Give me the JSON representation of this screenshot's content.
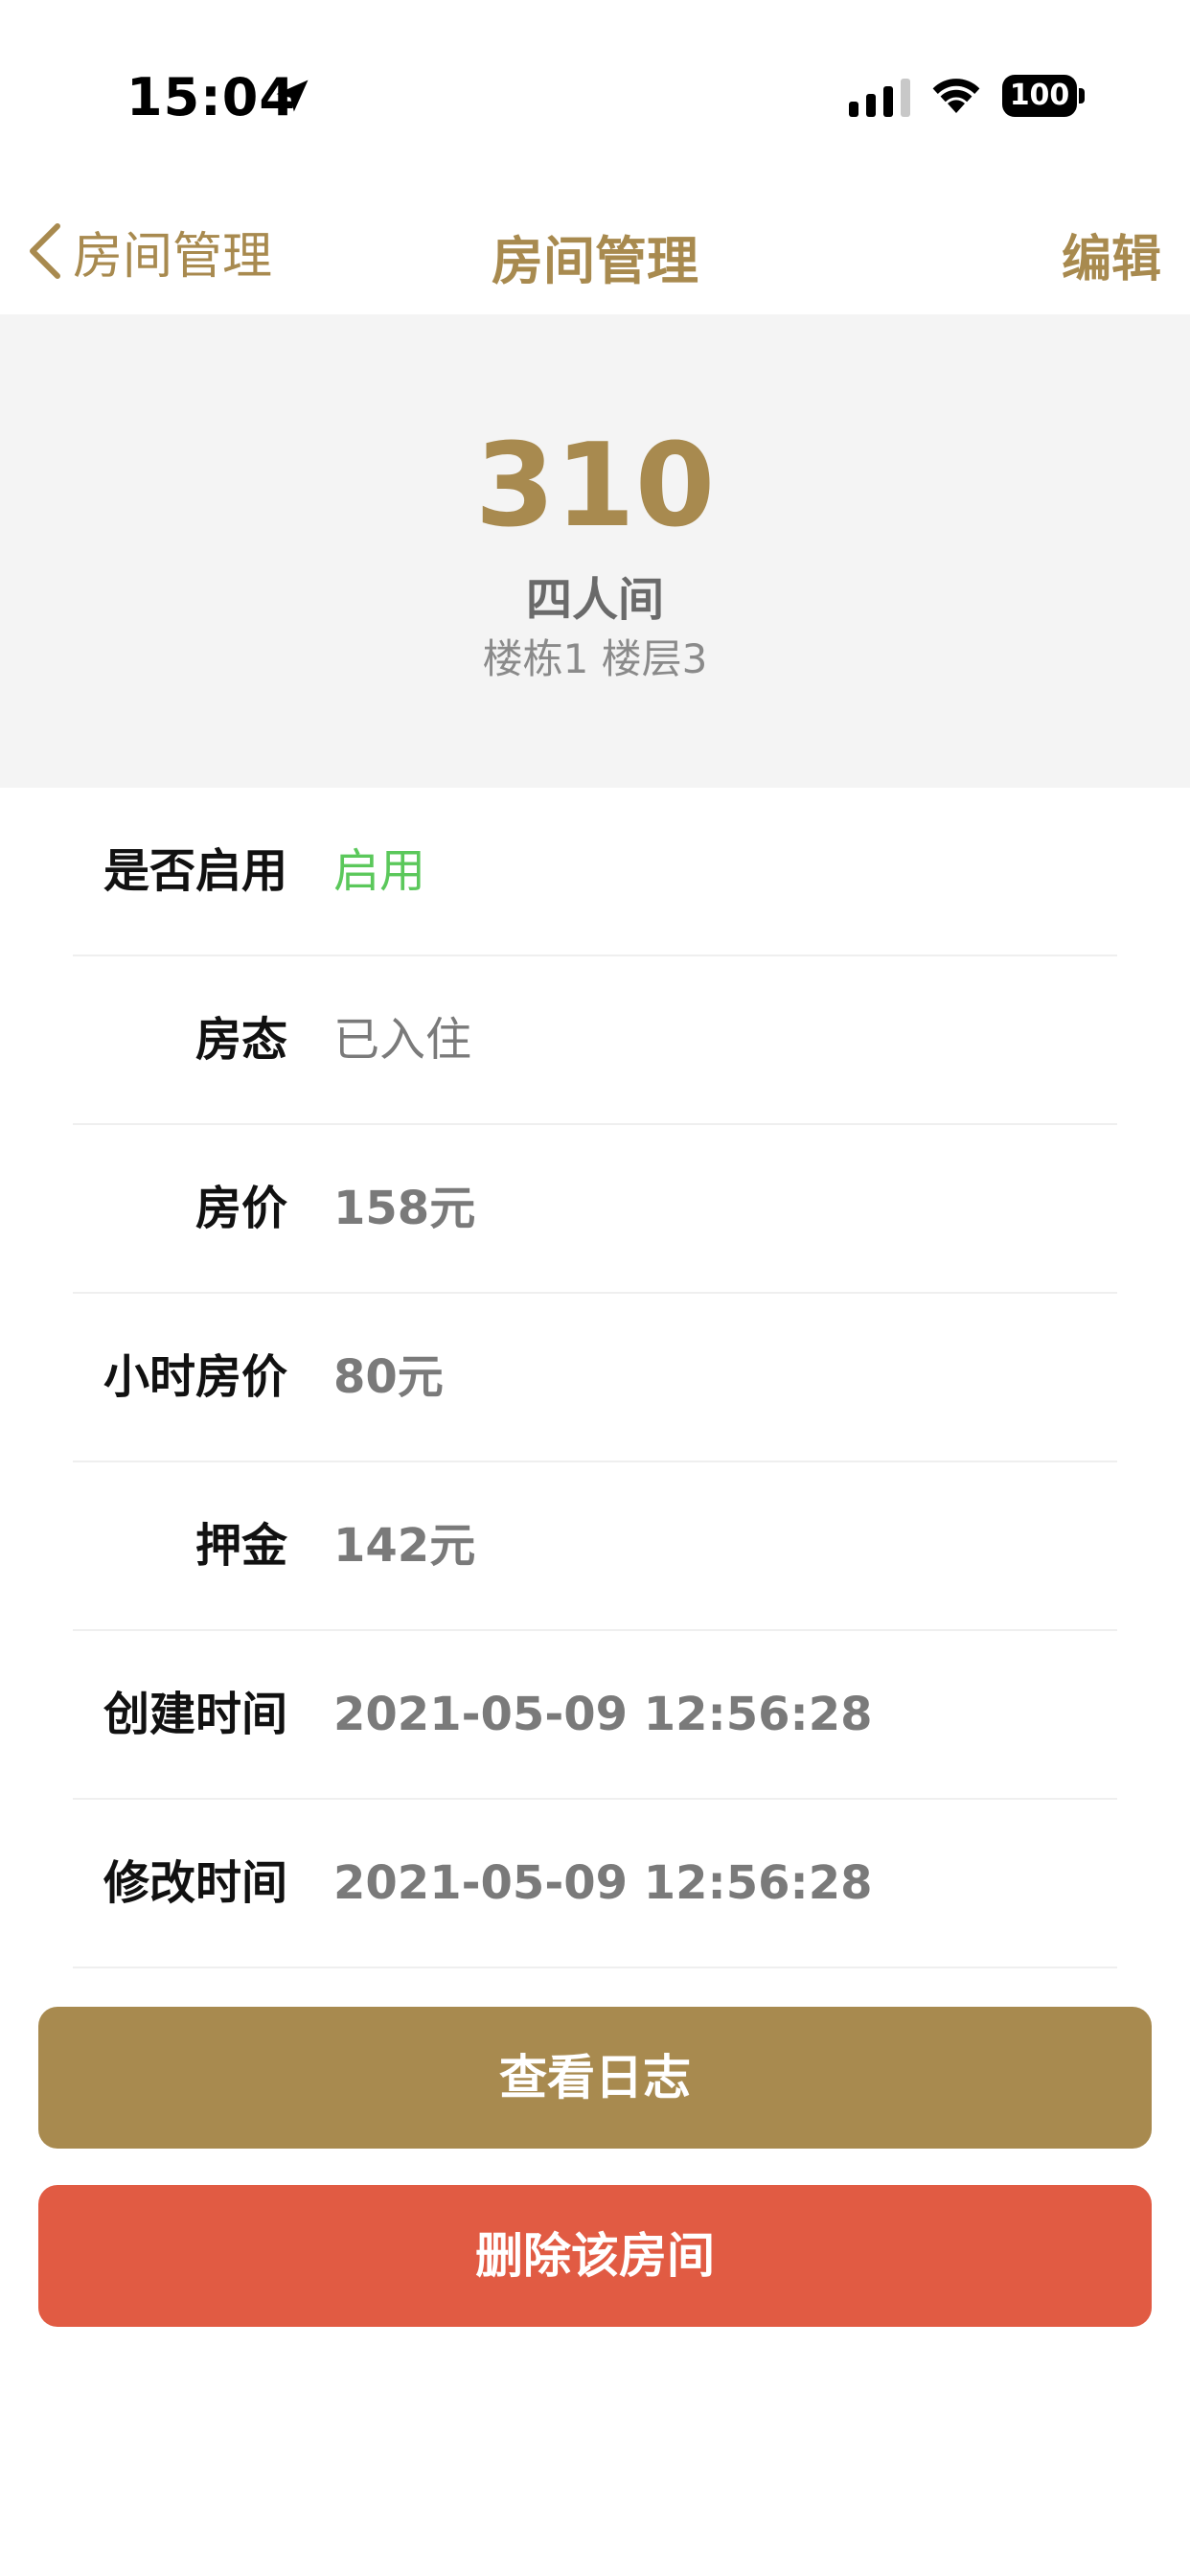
{
  "status_bar": {
    "time": "15:04",
    "battery": "100",
    "icons": [
      "location-arrow-icon",
      "cellular-signal-icon",
      "wifi-icon",
      "battery-icon"
    ]
  },
  "nav": {
    "back_label": "房间管理",
    "title": "房间管理",
    "edit_label": "编辑",
    "accent_color": "#A88A4F"
  },
  "room": {
    "number": "310",
    "type": "四人间",
    "location": "楼栋1 楼层3"
  },
  "details": [
    {
      "label": "是否启用",
      "value": "启用"
    },
    {
      "label": "房态",
      "value": "已入住"
    },
    {
      "label": "房价",
      "value": "158元"
    },
    {
      "label": "小时房价",
      "value": "80元"
    },
    {
      "label": "押金",
      "value": "142元"
    },
    {
      "label": "创建时间",
      "value": "2021-05-09 12:56:28"
    },
    {
      "label": "修改时间",
      "value": "2021-05-09 12:56:28"
    }
  ],
  "actions": {
    "view_log": "查看日志",
    "delete_room": "删除该房间"
  },
  "colors": {
    "enabled": "#5BC85B",
    "primary_button": "#A88A4F",
    "danger_button": "#E15B43",
    "header_bg": "#F4F4F4"
  }
}
